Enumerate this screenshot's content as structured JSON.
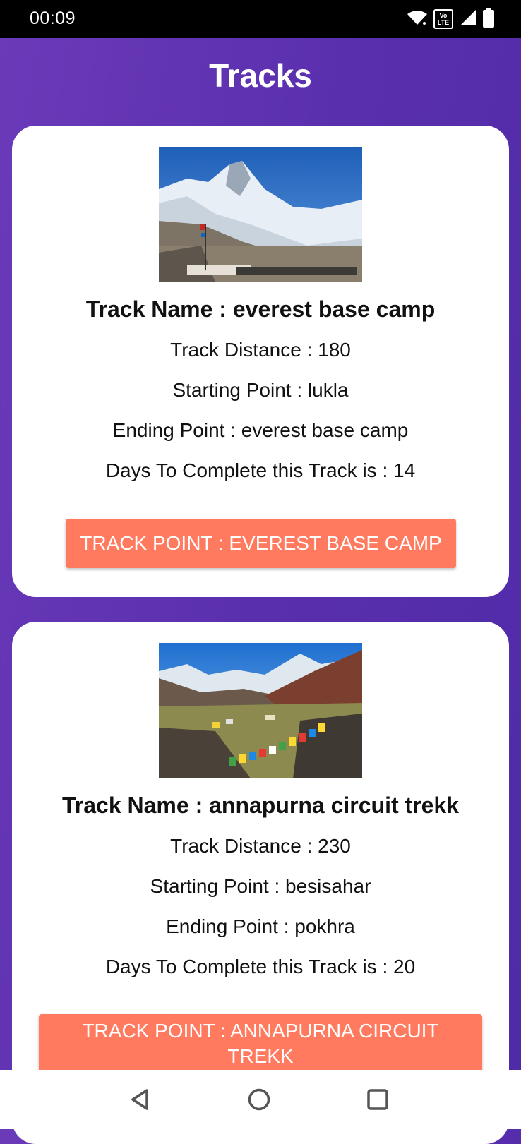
{
  "status_bar": {
    "time": "00:09",
    "icons": [
      "wifi-icon",
      "volte-icon",
      "signal-icon",
      "battery-icon"
    ],
    "lte_line1": "Vo",
    "lte_line2": "LTE"
  },
  "header": {
    "title": "Tracks"
  },
  "tracks": [
    {
      "name_line": "Track Name : everest base camp",
      "distance_line": "Track Distance : 180",
      "start_line": "Starting Point : lukla",
      "end_line": "Ending Point : everest base camp",
      "days_line": "Days To Complete this Track is : 14",
      "button_label": "TRACK POINT : EVEREST BASE CAMP"
    },
    {
      "name_line": "Track Name : annapurna circuit trekk",
      "distance_line": "Track Distance : 230",
      "start_line": "Starting Point : besisahar",
      "end_line": "Ending Point : pokhra",
      "days_line": "Days To Complete this Track is : 20",
      "button_label_line1": "TRACK POINT : ANNAPURNA CIRCUIT",
      "button_label_line2": "TREKK"
    }
  ],
  "nav_bar": {
    "icons": [
      "back-icon",
      "home-icon",
      "recents-icon"
    ]
  },
  "colors": {
    "accent_button": "#ff7a5f",
    "background": "#5a2fae"
  }
}
